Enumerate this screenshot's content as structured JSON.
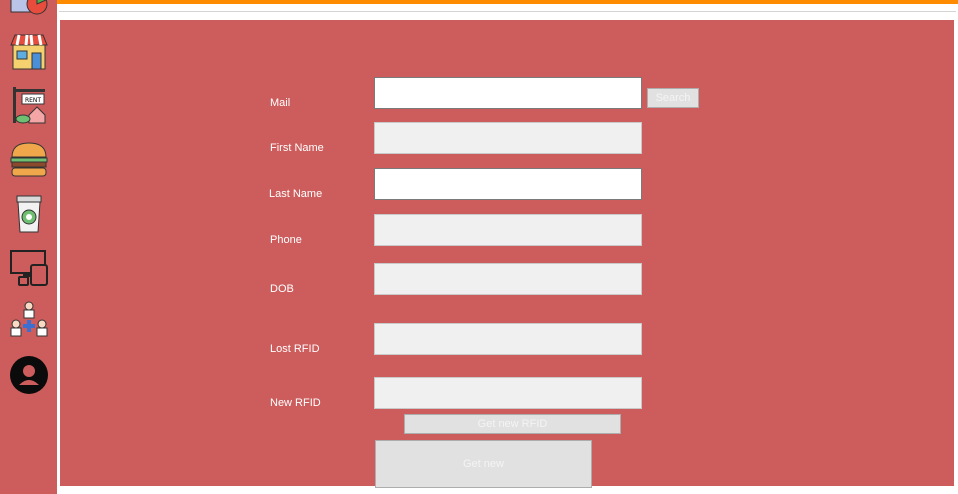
{
  "colors": {
    "panel_bg": "#cd5c5c",
    "accent_bar": "#ff8c00",
    "label_text": "#ffffff",
    "field_disabled": "#f0f0f0",
    "field_enabled": "#ffffff",
    "button_bg": "#e1e1e1"
  },
  "sidebar": {
    "items": [
      {
        "icon": "charts-icon"
      },
      {
        "icon": "store-icon"
      },
      {
        "icon": "rent-sign-icon",
        "sign_text": "RENT"
      },
      {
        "icon": "burger-icon"
      },
      {
        "icon": "coffee-cup-icon"
      },
      {
        "icon": "devices-icon"
      },
      {
        "icon": "team-medical-icon"
      },
      {
        "icon": "user-avatar-icon"
      }
    ]
  },
  "form": {
    "mail": {
      "label": "Mail",
      "value": ""
    },
    "first_name": {
      "label": "First Name",
      "value": ""
    },
    "last_name": {
      "label": "Last Name",
      "value": ""
    },
    "phone": {
      "label": "Phone",
      "value": ""
    },
    "dob": {
      "label": "DOB",
      "value": ""
    },
    "lost_rfid": {
      "label": "Lost RFID",
      "value": ""
    },
    "new_rfid": {
      "label": "New RFID",
      "value": ""
    }
  },
  "buttons": {
    "search": "Search",
    "get_new_rfid": "Get new RFID",
    "get_new": "Get new"
  }
}
